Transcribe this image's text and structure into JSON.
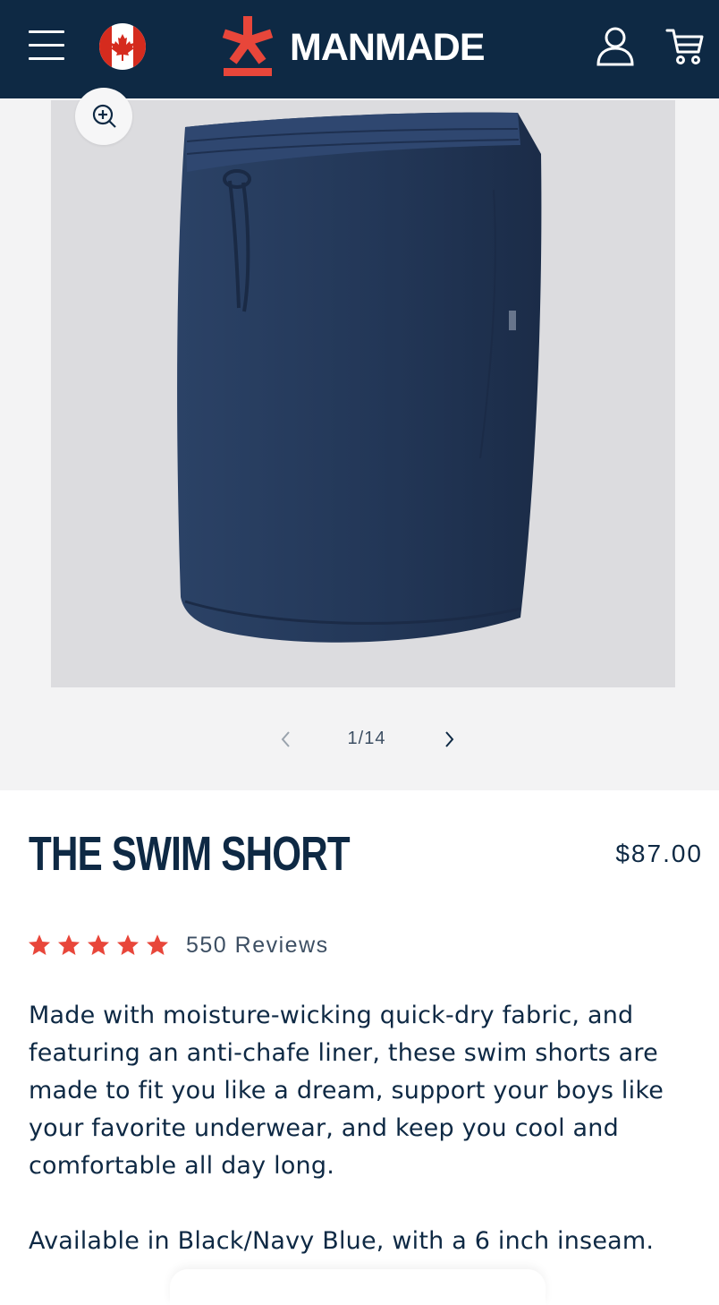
{
  "header": {
    "brand": "MANMADE",
    "icons": {
      "menu": "hamburger-menu-icon",
      "region": "canada-flag-icon",
      "logo": "asterisk-logo",
      "account": "user-account-icon",
      "cart": "shopping-cart-icon"
    }
  },
  "gallery": {
    "current": "1/14",
    "zoom_icon": "zoom-in-icon",
    "prev_icon": "chevron-left-icon",
    "next_icon": "chevron-right-icon"
  },
  "product": {
    "title": "THE SWIM SHORT",
    "price": "$87.00",
    "rating": 5,
    "reviews": "550 Reviews",
    "description": "Made with moisture-wicking quick-dry fabric, and featuring an anti-chafe liner, these swim shorts are made to fit you like a dream, support your boys like your favorite underwear, and keep you cool and comfortable all day long.",
    "availability": "Available in Black/Navy Blue, with a 6 inch inseam."
  },
  "colors": {
    "header_bg": "#0e2944",
    "accent": "#e8463a",
    "gallery_bg": "#f3f3f4",
    "product_color": "#253a5a"
  }
}
